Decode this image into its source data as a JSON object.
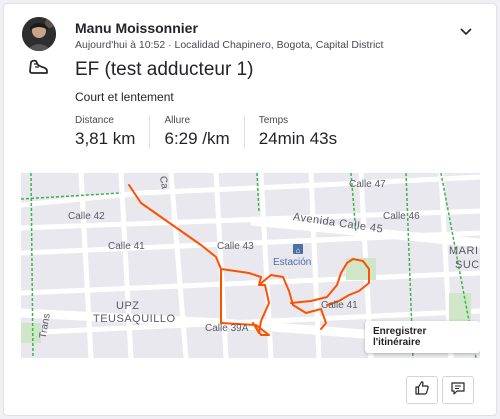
{
  "athlete": {
    "name": "Manu Moissonnier",
    "meta": "Aujourd'hui à 10:52 · Localidad Chapinero, Bogota, Capital District"
  },
  "activity": {
    "sport_icon": "running-shoe-icon",
    "title": "EF (test adducteur 1)",
    "description": "Court et lentement"
  },
  "stats": [
    {
      "label": "Distance",
      "value": "3,81 km"
    },
    {
      "label": "Allure",
      "value": "6:29 /km"
    },
    {
      "label": "Temps",
      "value": "24min 43s"
    }
  ],
  "map": {
    "route_color": "#fc5200",
    "save_route_label": "Enregistrer l'itinéraire",
    "labels": {
      "calle_47": "Calle 47",
      "calle_46": "Calle 46",
      "calle_45": "Avenida Calle 45",
      "calle_42": "Calle 42",
      "calle_43": "Calle 43",
      "calle_41a": "Calle 41",
      "calle_41b": "Calle 41",
      "calle_39": "Calle 39A",
      "carrera": "Ca",
      "estacion": "Estación",
      "upz1": "UPZ",
      "upz2": "TEUSAQUILLO",
      "mari": "MARI",
      "sucre": "SUC",
      "trans": "Trans"
    }
  },
  "actions": {
    "like_icon": "thumbs-up-icon",
    "comment_icon": "comment-icon"
  }
}
